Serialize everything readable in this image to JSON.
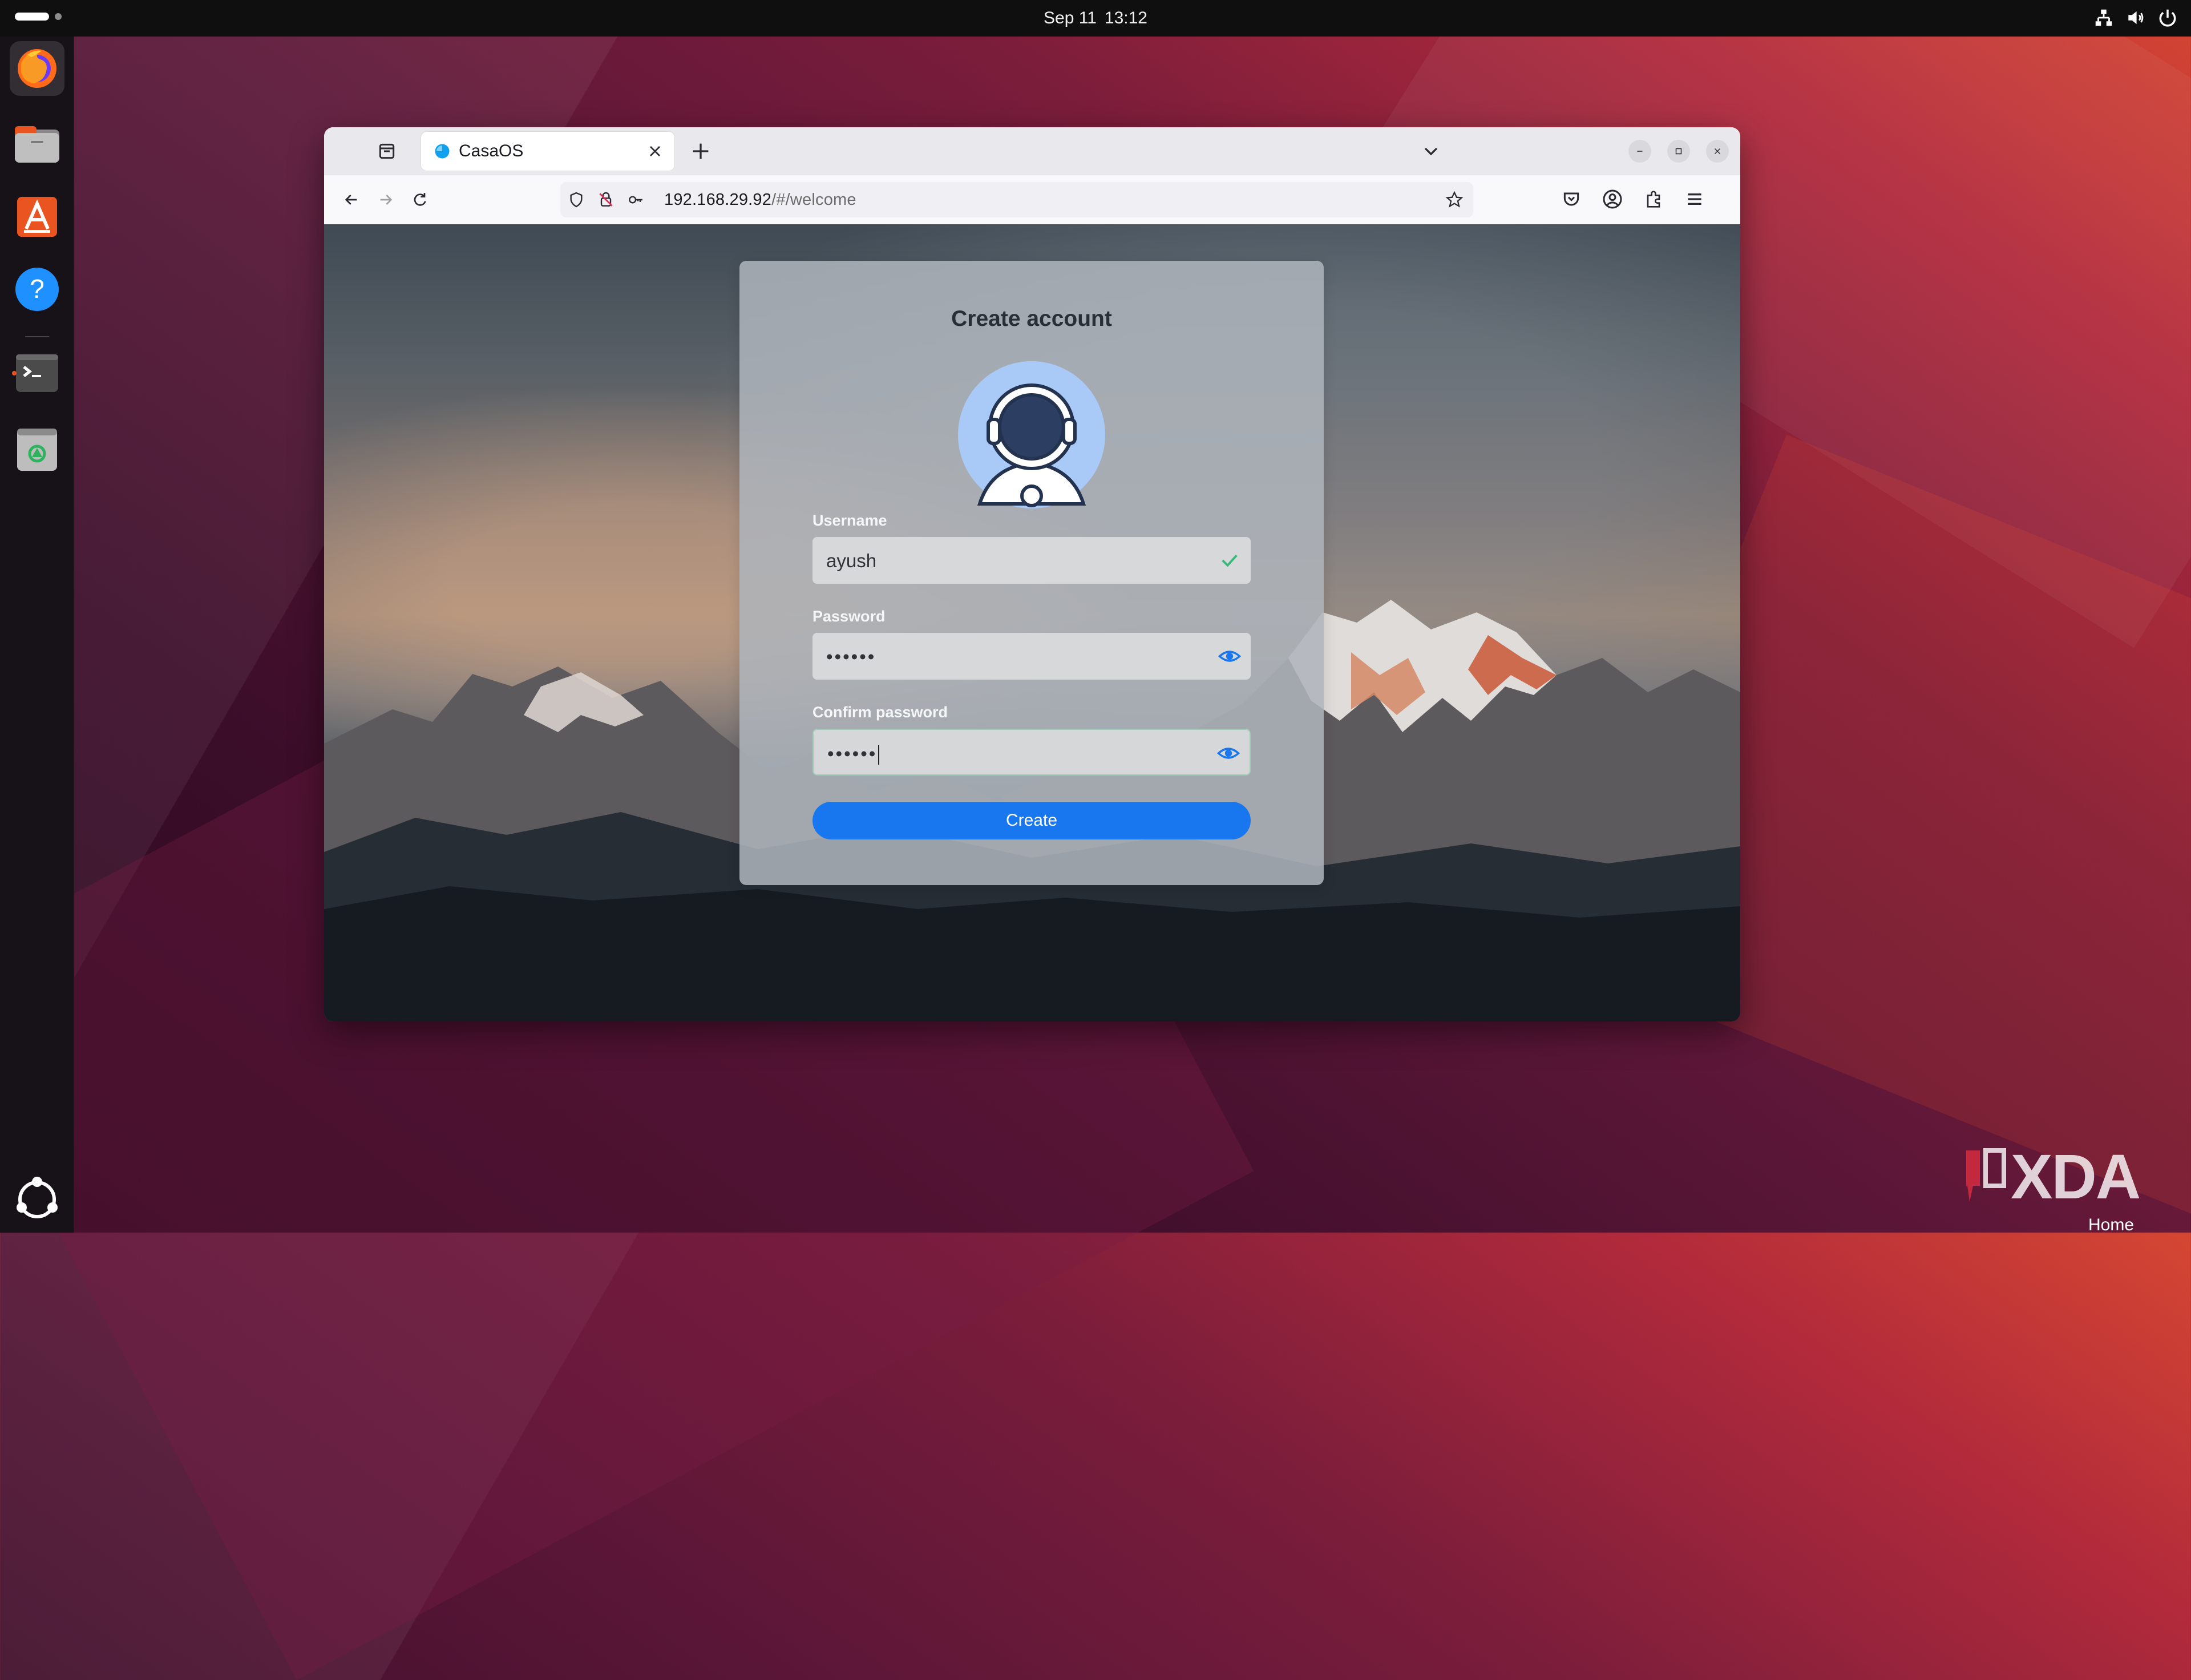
{
  "desktop": {
    "topbar": {
      "date": "Sep 11",
      "time": "13:12"
    },
    "watermark": "XDA",
    "corner_label": "Home"
  },
  "browser": {
    "tab": {
      "title": "CasaOS"
    },
    "url": {
      "host": "192.168.29.92",
      "path": "/#/welcome"
    }
  },
  "page": {
    "title": "Create account",
    "username_label": "Username",
    "username_value": "ayush",
    "password_label": "Password",
    "password_mask": "••••••",
    "confirm_label": "Confirm password",
    "confirm_mask": "••••••",
    "create_label": "Create"
  },
  "colors": {
    "accent": "#1876ee",
    "success": "#36b878"
  },
  "icons": {
    "dock": [
      "firefox-icon",
      "files-icon",
      "app-center-icon",
      "help-icon",
      "terminal-icon",
      "trash-icon",
      "ubuntu-icon"
    ]
  }
}
